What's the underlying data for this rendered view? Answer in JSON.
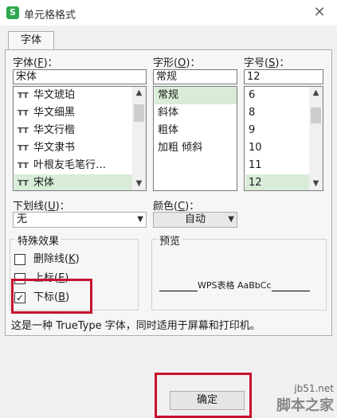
{
  "window": {
    "title": "单元格格式",
    "app_icon": "S",
    "close_glyph": "✕"
  },
  "tabs": [
    {
      "label": "字体"
    }
  ],
  "font": {
    "label_text": "字体(",
    "label_key": "F",
    "label_end": ")：",
    "value": "宋体",
    "items": [
      "华文琥珀",
      "华文细黑",
      "华文行楷",
      "华文隶书",
      "叶根友毛笔行…",
      "宋体"
    ],
    "selected_index": 5
  },
  "style": {
    "label_text": "字形(",
    "label_key": "O",
    "label_end": ")：",
    "value": "常规",
    "items": [
      "常规",
      "斜体",
      "粗体",
      "加粗 倾斜"
    ],
    "selected_index": 0
  },
  "size": {
    "label_text": "字号(",
    "label_key": "S",
    "label_end": ")：",
    "value": "12",
    "items": [
      "6",
      "8",
      "9",
      "10",
      "11",
      "12"
    ],
    "selected_index": 5
  },
  "underline": {
    "label_text": "下划线(",
    "label_key": "U",
    "label_end": ")：",
    "value": "无"
  },
  "color": {
    "label_text": "颜色(",
    "label_key": "C",
    "label_end": ")：",
    "value": "自动"
  },
  "effects": {
    "title": "特殊效果",
    "items": [
      {
        "label": "删除线(",
        "key": "K",
        "end": ")",
        "checked": false
      },
      {
        "label": "上标(",
        "key": "E",
        "end": ")",
        "checked": false
      },
      {
        "label": "下标(",
        "key": "B",
        "end": ")",
        "checked": true
      }
    ]
  },
  "preview": {
    "title": "预览",
    "sample": "WPS表格  AaBbCc"
  },
  "info_text": "这是一种 TrueType 字体，同时适用于屏幕和打印机。",
  "buttons": {
    "ok": "确定"
  },
  "watermark": {
    "url": "jb51.net",
    "name": "脚本之家"
  },
  "icons": {
    "truetype": "TT",
    "scroll_up": "▲",
    "scroll_down": "▼",
    "dropdown": "▼",
    "check": "✓"
  },
  "colors": {
    "accent_red": "#c8102e",
    "selection": "#d8ecd8",
    "app_green": "#2fa84f"
  }
}
